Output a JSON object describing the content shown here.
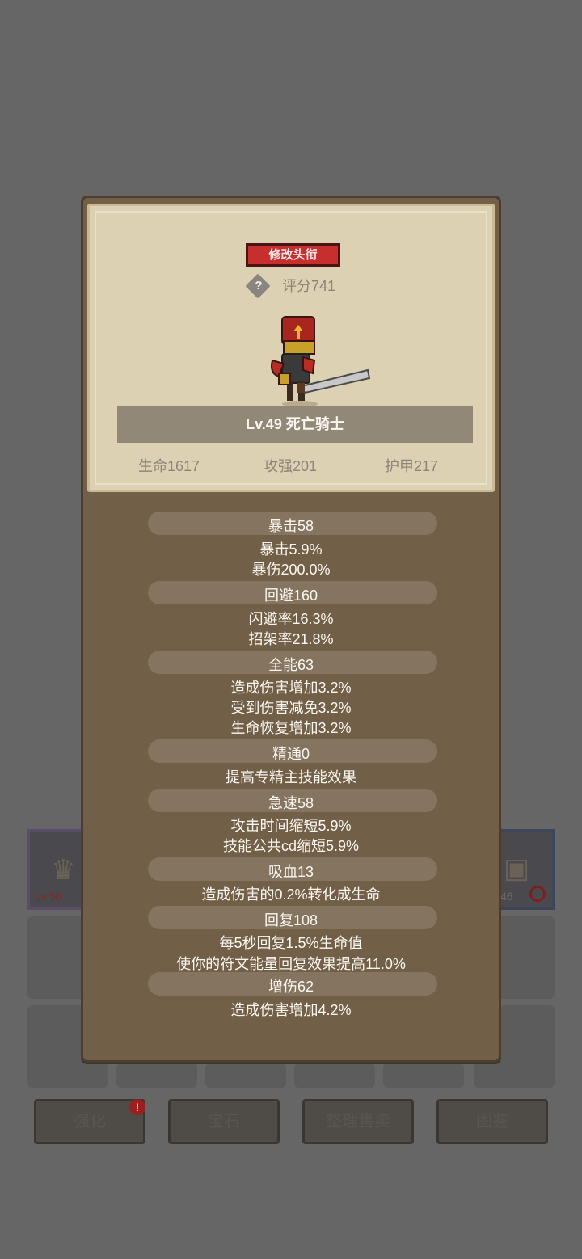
{
  "modal": {
    "title_button": "修改头衔",
    "help_icon": "question-diamond-icon",
    "score": "评分741",
    "hero_name": "Lv.49 死亡骑士",
    "base_stats": [
      "生命1617",
      "攻强201",
      "护甲217"
    ],
    "sections": [
      {
        "header": "暴击58",
        "lines": [
          "暴击5.9%",
          "暴伤200.0%"
        ]
      },
      {
        "header": "回避160",
        "lines": [
          "闪避率16.3%",
          "招架率21.8%"
        ]
      },
      {
        "header": "全能63",
        "lines": [
          "造成伤害增加3.2%",
          "受到伤害减免3.2%",
          "生命恢复增加3.2%"
        ]
      },
      {
        "header": "精通0",
        "lines": [
          "提高专精主技能效果"
        ]
      },
      {
        "header": "急速58",
        "lines": [
          "攻击时间缩短5.9%",
          "技能公共cd缩短5.9%"
        ]
      },
      {
        "header": "吸血13",
        "lines": [
          "造成伤害的0.2%转化成生命"
        ]
      },
      {
        "header": "回复108",
        "lines": [
          "每5秒回复1.5%生命值",
          "使你的符文能量回复效果提高11.0%"
        ]
      },
      {
        "header": "增伤62",
        "lines": [
          "造成伤害增加4.2%"
        ]
      }
    ]
  },
  "background": {
    "left_slot_level": "Lv.50",
    "right_slot_level": "46",
    "badge": "!",
    "buttons": [
      "强化",
      "宝石",
      "整理售卖",
      "图鉴"
    ]
  },
  "colors": {
    "modal_bg": "#715f48",
    "parchment": "#ddd1b3",
    "title_button": "#c72f2f",
    "section_header": "#847460"
  }
}
